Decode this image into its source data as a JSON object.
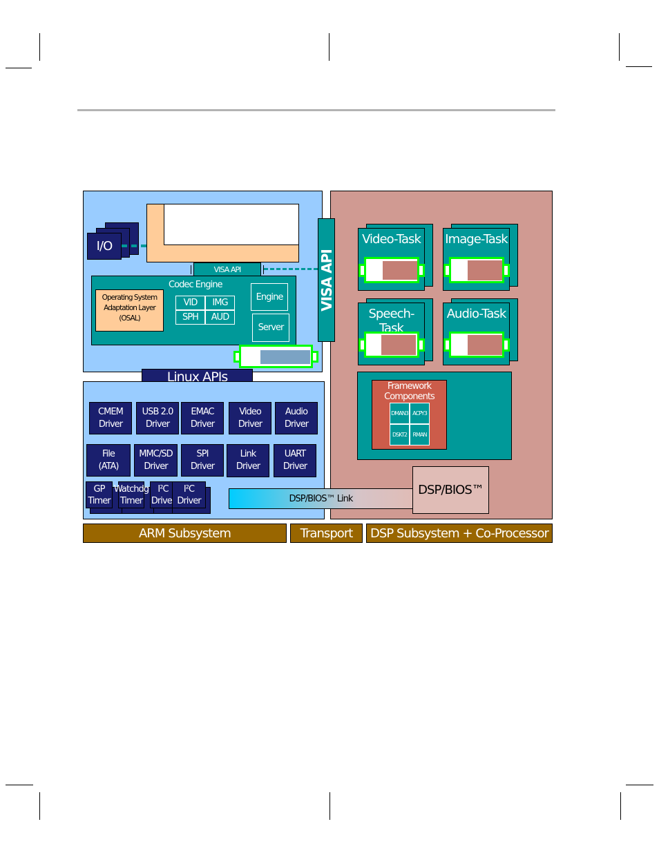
{
  "diagram": {
    "io_label": "I/O",
    "visa_api_small": "VISA API",
    "visa_api_vertical": "VISA API",
    "codec_engine": "Codec Engine",
    "osal": [
      "Operating System",
      "Adaptation Layer",
      "(OSAL)"
    ],
    "codec_grid": [
      "VID",
      "IMG",
      "SPH",
      "AUD"
    ],
    "engine": "Engine",
    "server": "Server",
    "linux_apis": "Linux APIs",
    "drivers_row1": [
      [
        "CMEM",
        "Driver"
      ],
      [
        "USB 2.0",
        "Driver"
      ],
      [
        "EMAC",
        "Driver"
      ],
      [
        "Video",
        "Driver"
      ],
      [
        "Audio",
        "Driver"
      ]
    ],
    "drivers_row2": [
      [
        "File",
        "(ATA)"
      ],
      [
        "MMC/SD",
        "Driver"
      ],
      [
        "SPI",
        "Driver"
      ],
      [
        "Link",
        "Driver"
      ],
      [
        "UART",
        "Driver"
      ]
    ],
    "drivers_row3": [
      [
        "GP",
        "Timer"
      ],
      [
        "Watchdg",
        "Timer"
      ],
      [
        "I²C",
        "Driver"
      ]
    ],
    "tasks": [
      "Video-Task",
      "Image-Task",
      "Speech-Task",
      "Audio-Task"
    ],
    "framework": [
      "Framework",
      "Components"
    ],
    "framework_grid": [
      "DMAN3",
      "ACPY3",
      "DSKT2",
      "RMAN"
    ],
    "dsp_bios": "DSP/BIOS™",
    "dsp_bios_link": "DSP/BIOS™ Link",
    "bars": [
      "ARM Subsystem",
      "Transport",
      "DSP Subsystem + Co-Processor"
    ],
    "colors": {
      "arm": "#99ccff",
      "dsp": "#d09a92",
      "navy": "#1a1f6e",
      "teal": "#009999",
      "peach": "#ffcc99",
      "bar": "#996600",
      "green": "#00ff00",
      "framework": "#cc5c4a"
    }
  }
}
